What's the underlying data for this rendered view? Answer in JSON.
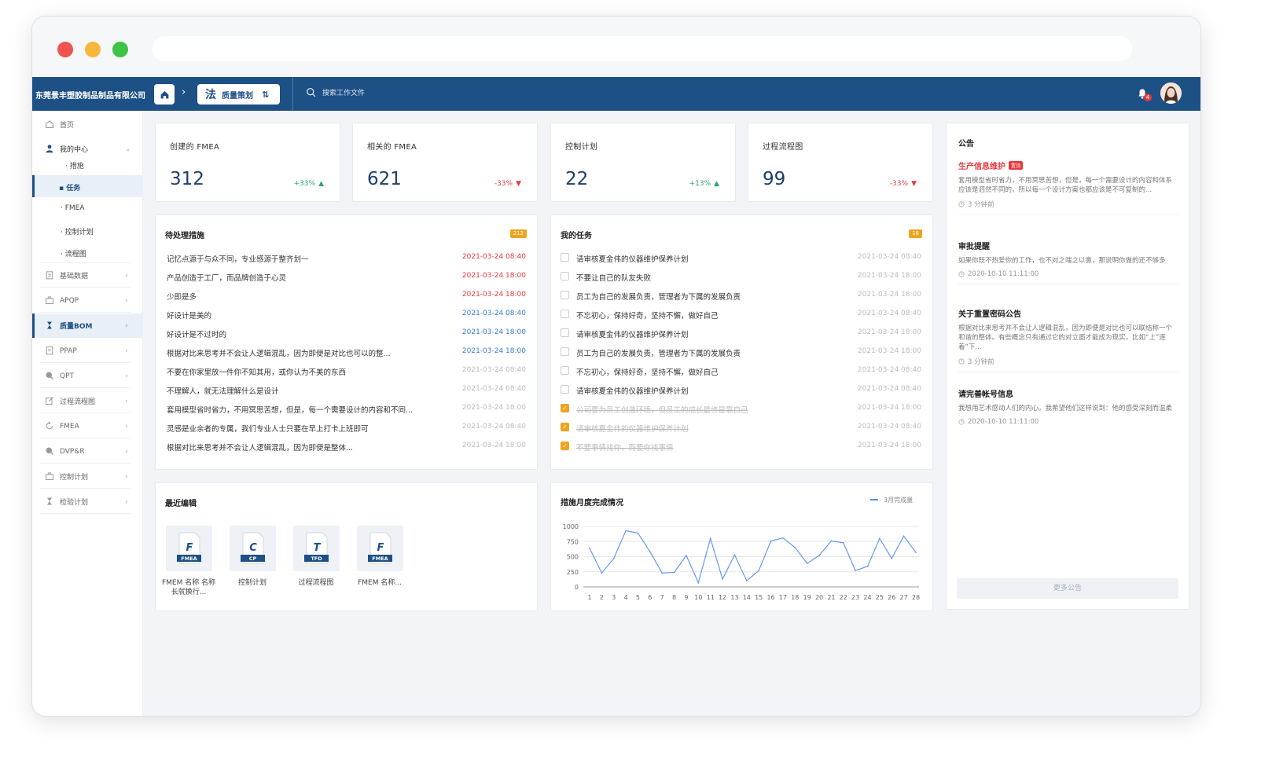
{
  "header": {
    "company": "东莞景丰塑胶制品制品有限公司",
    "module_glyph": "法",
    "module_label": "质量策划",
    "switch_glyph": "⇅",
    "search_placeholder": "搜索工作文件",
    "notification_count": "4"
  },
  "sidebar": {
    "home": "首页",
    "my_center": "我的中心",
    "sub_items": [
      "措施",
      "任务",
      "FMEA",
      "控制计划",
      "流程图"
    ],
    "items": [
      "基础数据",
      "APQP",
      "质量BOM",
      "PPAP",
      "QPT",
      "过程流程图",
      "FMEA",
      "DVP&R",
      "控制计划",
      "检验计划"
    ]
  },
  "kpis": [
    {
      "title": "创建的 FMEA",
      "value": "312",
      "change": "+33%",
      "trend": "up"
    },
    {
      "title": "相关的 FMEA",
      "value": "621",
      "change": "-33%",
      "trend": "down"
    },
    {
      "title": "控制计划",
      "value": "22",
      "change": "+13%",
      "trend": "up"
    },
    {
      "title": "过程流程图",
      "value": "99",
      "change": "-33%",
      "trend": "down"
    }
  ],
  "pending": {
    "title": "待处理措施",
    "count": "212",
    "rows": [
      {
        "text": "记忆点源于与众不同，专业感源于整齐划一",
        "time": "2021-03-24 08:40",
        "color": "#e8383d"
      },
      {
        "text": "产品创造于工厂，而品牌创造于心灵",
        "time": "2021-03-24 18:00",
        "color": "#e8383d"
      },
      {
        "text": "少即是多",
        "time": "2021-03-24 18:00",
        "color": "#e8383d"
      },
      {
        "text": "好设计是美的",
        "time": "2021-03-24 08:40",
        "color": "#3b7ad8"
      },
      {
        "text": "好设计是不过时的",
        "time": "2021-03-24 18:00",
        "color": "#3b7ad8"
      },
      {
        "text": "根据对比来思考并不会让人逻辑混乱，因为即便是对比也可以的整...",
        "time": "2021-03-24 18:00",
        "color": "#3b7ad8"
      },
      {
        "text": "不要在你家里放一件你不知其用，或你认为不美的东西",
        "time": "2021-03-24 08:40",
        "color": "#bbbbbb"
      },
      {
        "text": "不理解人，就无法理解什么是设计",
        "time": "2021-03-24 08:40",
        "color": "#bbbbbb"
      },
      {
        "text": "套用模型省时省力，不用冥思苦想，但是，每一个需要设计的内容和不同...",
        "time": "2021-03-24 18:00",
        "color": "#bbbbbb"
      },
      {
        "text": "灵感是业余者的专属，我们专业人士只要在早上打卡上班即可",
        "time": "2021-03-24 08:40",
        "color": "#bbbbbb"
      },
      {
        "text": "根据对比来思考并不会让人逻辑混乱，因为即便是整体...",
        "time": "2021-03-24 18:00",
        "color": "#bbbbbb"
      }
    ]
  },
  "tasks": {
    "title": "我的任务",
    "count": "18",
    "rows": [
      {
        "text": "请审核夏金伟的仪器维护保养计划",
        "time": "2021-03-24 08:40",
        "done": false
      },
      {
        "text": "不要让自己的队友失败",
        "time": "2021-03-24 18:00",
        "done": false
      },
      {
        "text": "员工为自己的发展负责，管理者为下属的发展负责",
        "time": "2021-03-24 18:00",
        "done": false
      },
      {
        "text": "不忘初心，保持好奇，坚持不懈，做好自己",
        "time": "2021-03-24 08:40",
        "done": false
      },
      {
        "text": "请审核夏金伟的仪器维护保养计划",
        "time": "2021-03-24 18:00",
        "done": false
      },
      {
        "text": "员工为自己的发展负责，管理者为下属的发展负责",
        "time": "2021-03-24 18:00",
        "done": false
      },
      {
        "text": "不忘初心，保持好奇，坚持不懈，做好自己",
        "time": "2021-03-24 08:40",
        "done": false
      },
      {
        "text": "请审核夏金伟的仪器维护保养计划",
        "time": "2021-03-24 08:40",
        "done": false
      },
      {
        "text": "公司要为员工创造环境，但员工的成长最终是靠自己",
        "time": "2021-03-24 18:00",
        "done": true
      },
      {
        "text": "请审核夏金伟的仪器维护保养计划",
        "time": "2021-03-24 08:40",
        "done": true
      },
      {
        "text": "不要事情找你，而要你找事情",
        "time": "2021-03-24 18:00",
        "done": true
      }
    ]
  },
  "recent": {
    "title": "最近编辑",
    "files": [
      {
        "letter": "F",
        "tag": "FMEA",
        "name": "FMEM 名称 名称长就换行..."
      },
      {
        "letter": "C",
        "tag": "CP",
        "name": "控制计划"
      },
      {
        "letter": "T",
        "tag": "TFD",
        "name": "过程流程图"
      },
      {
        "letter": "F",
        "tag": "FMEA",
        "name": "FMEM 名称..."
      }
    ]
  },
  "chart_panel": {
    "title": "措施月度完成情况"
  },
  "chart_data": {
    "type": "line",
    "title": "措施月度完成情况",
    "x": [
      1,
      2,
      3,
      4,
      5,
      6,
      7,
      8,
      9,
      10,
      11,
      12,
      13,
      14,
      15,
      16,
      17,
      18,
      19,
      20,
      21,
      22,
      23,
      24,
      25,
      26,
      27,
      28
    ],
    "series": [
      {
        "name": "3月完成量",
        "values": [
          640,
          230,
          470,
          930,
          890,
          580,
          230,
          240,
          520,
          70,
          800,
          130,
          530,
          100,
          270,
          760,
          810,
          650,
          390,
          520,
          760,
          730,
          270,
          340,
          800,
          470,
          840,
          570
        ]
      }
    ],
    "ylim": [
      0,
      1000
    ],
    "yticks": [
      0,
      250,
      500,
      750,
      1000
    ],
    "xlabel": "",
    "ylabel": "",
    "grid": true,
    "legend": "top-right",
    "color": "#5b8ff9"
  },
  "notices": {
    "title": "公告",
    "items": [
      {
        "title": "生产信息维护",
        "tag": "置顶",
        "highlight": true,
        "body": "套用模型省时省力，不用冥思苦想，但是，每一个需要设计的内容和体系应该是迥然不同的，所以每一个设计方案也都应该是不可复制的...",
        "time": "3 分钟前"
      },
      {
        "title": "审批提醒",
        "highlight": false,
        "body": "如果你既不热爱你的工作，也不对之嗤之以鼻，那说明你做的还不够多",
        "time": "2020-10-10 11:11:00"
      },
      {
        "title": "关于重置密码公告",
        "highlight": false,
        "body": "根据对比来思考并不会让人逻辑混乱，因为即便是对比也可以联结称一个和谐的整体。有些概念只有通过它的对立面才能成为现实，比如“上”连着“下...",
        "time": "3 分钟前"
      },
      {
        "title": "请完善帐号信息",
        "highlight": false,
        "body": "我想用艺术感动人们的内心。我希望他们这样说到：他的感受深刻而温柔",
        "time": "2020-10-10 11:11:00"
      }
    ],
    "more_label": "更多公告"
  },
  "colors": {
    "primary": "#1d5084",
    "up": "#2ea66d",
    "down": "#e8383d",
    "badge": "#f0a21e",
    "line": "#5b8ff9"
  }
}
